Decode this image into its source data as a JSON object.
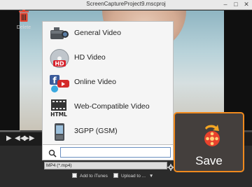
{
  "window": {
    "title": "ScreenCaptureProject9.mscproj"
  },
  "player": {},
  "menu": {
    "items": [
      {
        "label": "General Video",
        "icon": "camcorder-icon"
      },
      {
        "label": "HD Video",
        "icon": "hd-disc-icon"
      },
      {
        "label": "Online Video",
        "icon": "social-media-icon"
      },
      {
        "label": "Web-Compatible Video",
        "icon": "html-film-icon"
      },
      {
        "label": "3GPP (GSM)",
        "icon": "mobile-phone-icon"
      }
    ],
    "search": {
      "value": "",
      "placeholder": ""
    }
  },
  "output": {
    "format": "MP4 (*.mp4)",
    "add_itunes_label": "Add to iTunes",
    "add_itunes_checked": false,
    "upload_label": "Upload to ...",
    "upload_checked": false
  },
  "toolbar": {
    "delete_label": "Delete",
    "save_label": "Save"
  },
  "colors": {
    "save_border": "#f08a1e",
    "menu_bg": "#f5f5f5",
    "app_bg": "#2b2b2b"
  }
}
